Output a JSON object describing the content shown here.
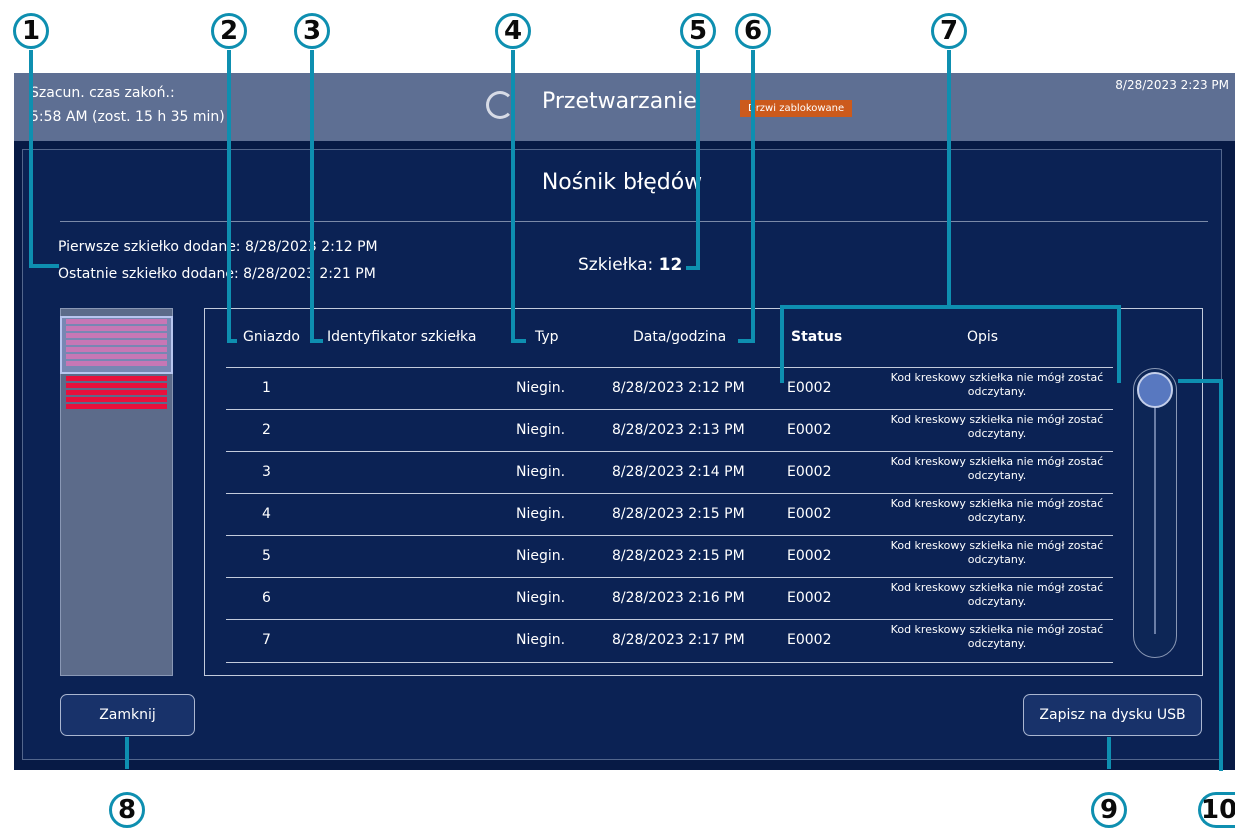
{
  "callouts": [
    "1",
    "2",
    "3",
    "4",
    "5",
    "6",
    "7",
    "8",
    "9",
    "10"
  ],
  "header": {
    "eta_label": "Szacun. czas zakoń.:",
    "eta_value": "5:58 AM (zost. 15 h 35 min)",
    "status_title": "Przetwarzanie",
    "door_badge": "Drzwi zablokowane",
    "datetime": "8/28/2023 2:23 PM",
    "spinner_icon": "spinner-icon"
  },
  "dialog": {
    "title": "Nośnik błędów",
    "first_slide_label": "Pierwsze szkiełko dodane:",
    "first_slide_time": "8/28/2023 2:12 PM",
    "last_slide_label": "Ostatnie szkiełko dodane:",
    "last_slide_time": "8/28/2023 2:21 PM",
    "slides_label": "Szkiełka:",
    "slides_count": "12"
  },
  "table": {
    "columns": {
      "slot": "Gniazdo",
      "slide_id": "Identyfikator szkiełka",
      "type": "Typ",
      "datetime": "Data/godzina",
      "status": "Status",
      "description": "Opis"
    },
    "rows": [
      {
        "slot": "1",
        "slide_id": "",
        "type": "Niegin.",
        "datetime": "8/28/2023 2:12 PM",
        "status": "E0002",
        "description": "Kod kreskowy szkiełka nie mógł zostać odczytany."
      },
      {
        "slot": "2",
        "slide_id": "",
        "type": "Niegin.",
        "datetime": "8/28/2023 2:13 PM",
        "status": "E0002",
        "description": "Kod kreskowy szkiełka nie mógł zostać odczytany."
      },
      {
        "slot": "3",
        "slide_id": "",
        "type": "Niegin.",
        "datetime": "8/28/2023 2:14 PM",
        "status": "E0002",
        "description": "Kod kreskowy szkiełka nie mógł zostać odczytany."
      },
      {
        "slot": "4",
        "slide_id": "",
        "type": "Niegin.",
        "datetime": "8/28/2023 2:15 PM",
        "status": "E0002",
        "description": "Kod kreskowy szkiełka nie mógł zostać odczytany."
      },
      {
        "slot": "5",
        "slide_id": "",
        "type": "Niegin.",
        "datetime": "8/28/2023 2:15 PM",
        "status": "E0002",
        "description": "Kod kreskowy szkiełka nie mógł zostać odczytany."
      },
      {
        "slot": "6",
        "slide_id": "",
        "type": "Niegin.",
        "datetime": "8/28/2023 2:16 PM",
        "status": "E0002",
        "description": "Kod kreskowy szkiełka nie mógł zostać odczytany."
      },
      {
        "slot": "7",
        "slide_id": "",
        "type": "Niegin.",
        "datetime": "8/28/2023 2:17 PM",
        "status": "E0002",
        "description": "Kod kreskowy szkiełka nie mógł zostać odczytany."
      }
    ]
  },
  "overview": {
    "error_color": "#e8103c",
    "visible_color": "#d8528e",
    "slots_shown": 12
  },
  "buttons": {
    "close": "Zamknij",
    "save_usb": "Zapisz na dysku USB"
  },
  "colors": {
    "background": "#071a45",
    "header": "#5e6f93",
    "badge": "#cc5a1c",
    "callout_line": "#0e8fb0"
  }
}
